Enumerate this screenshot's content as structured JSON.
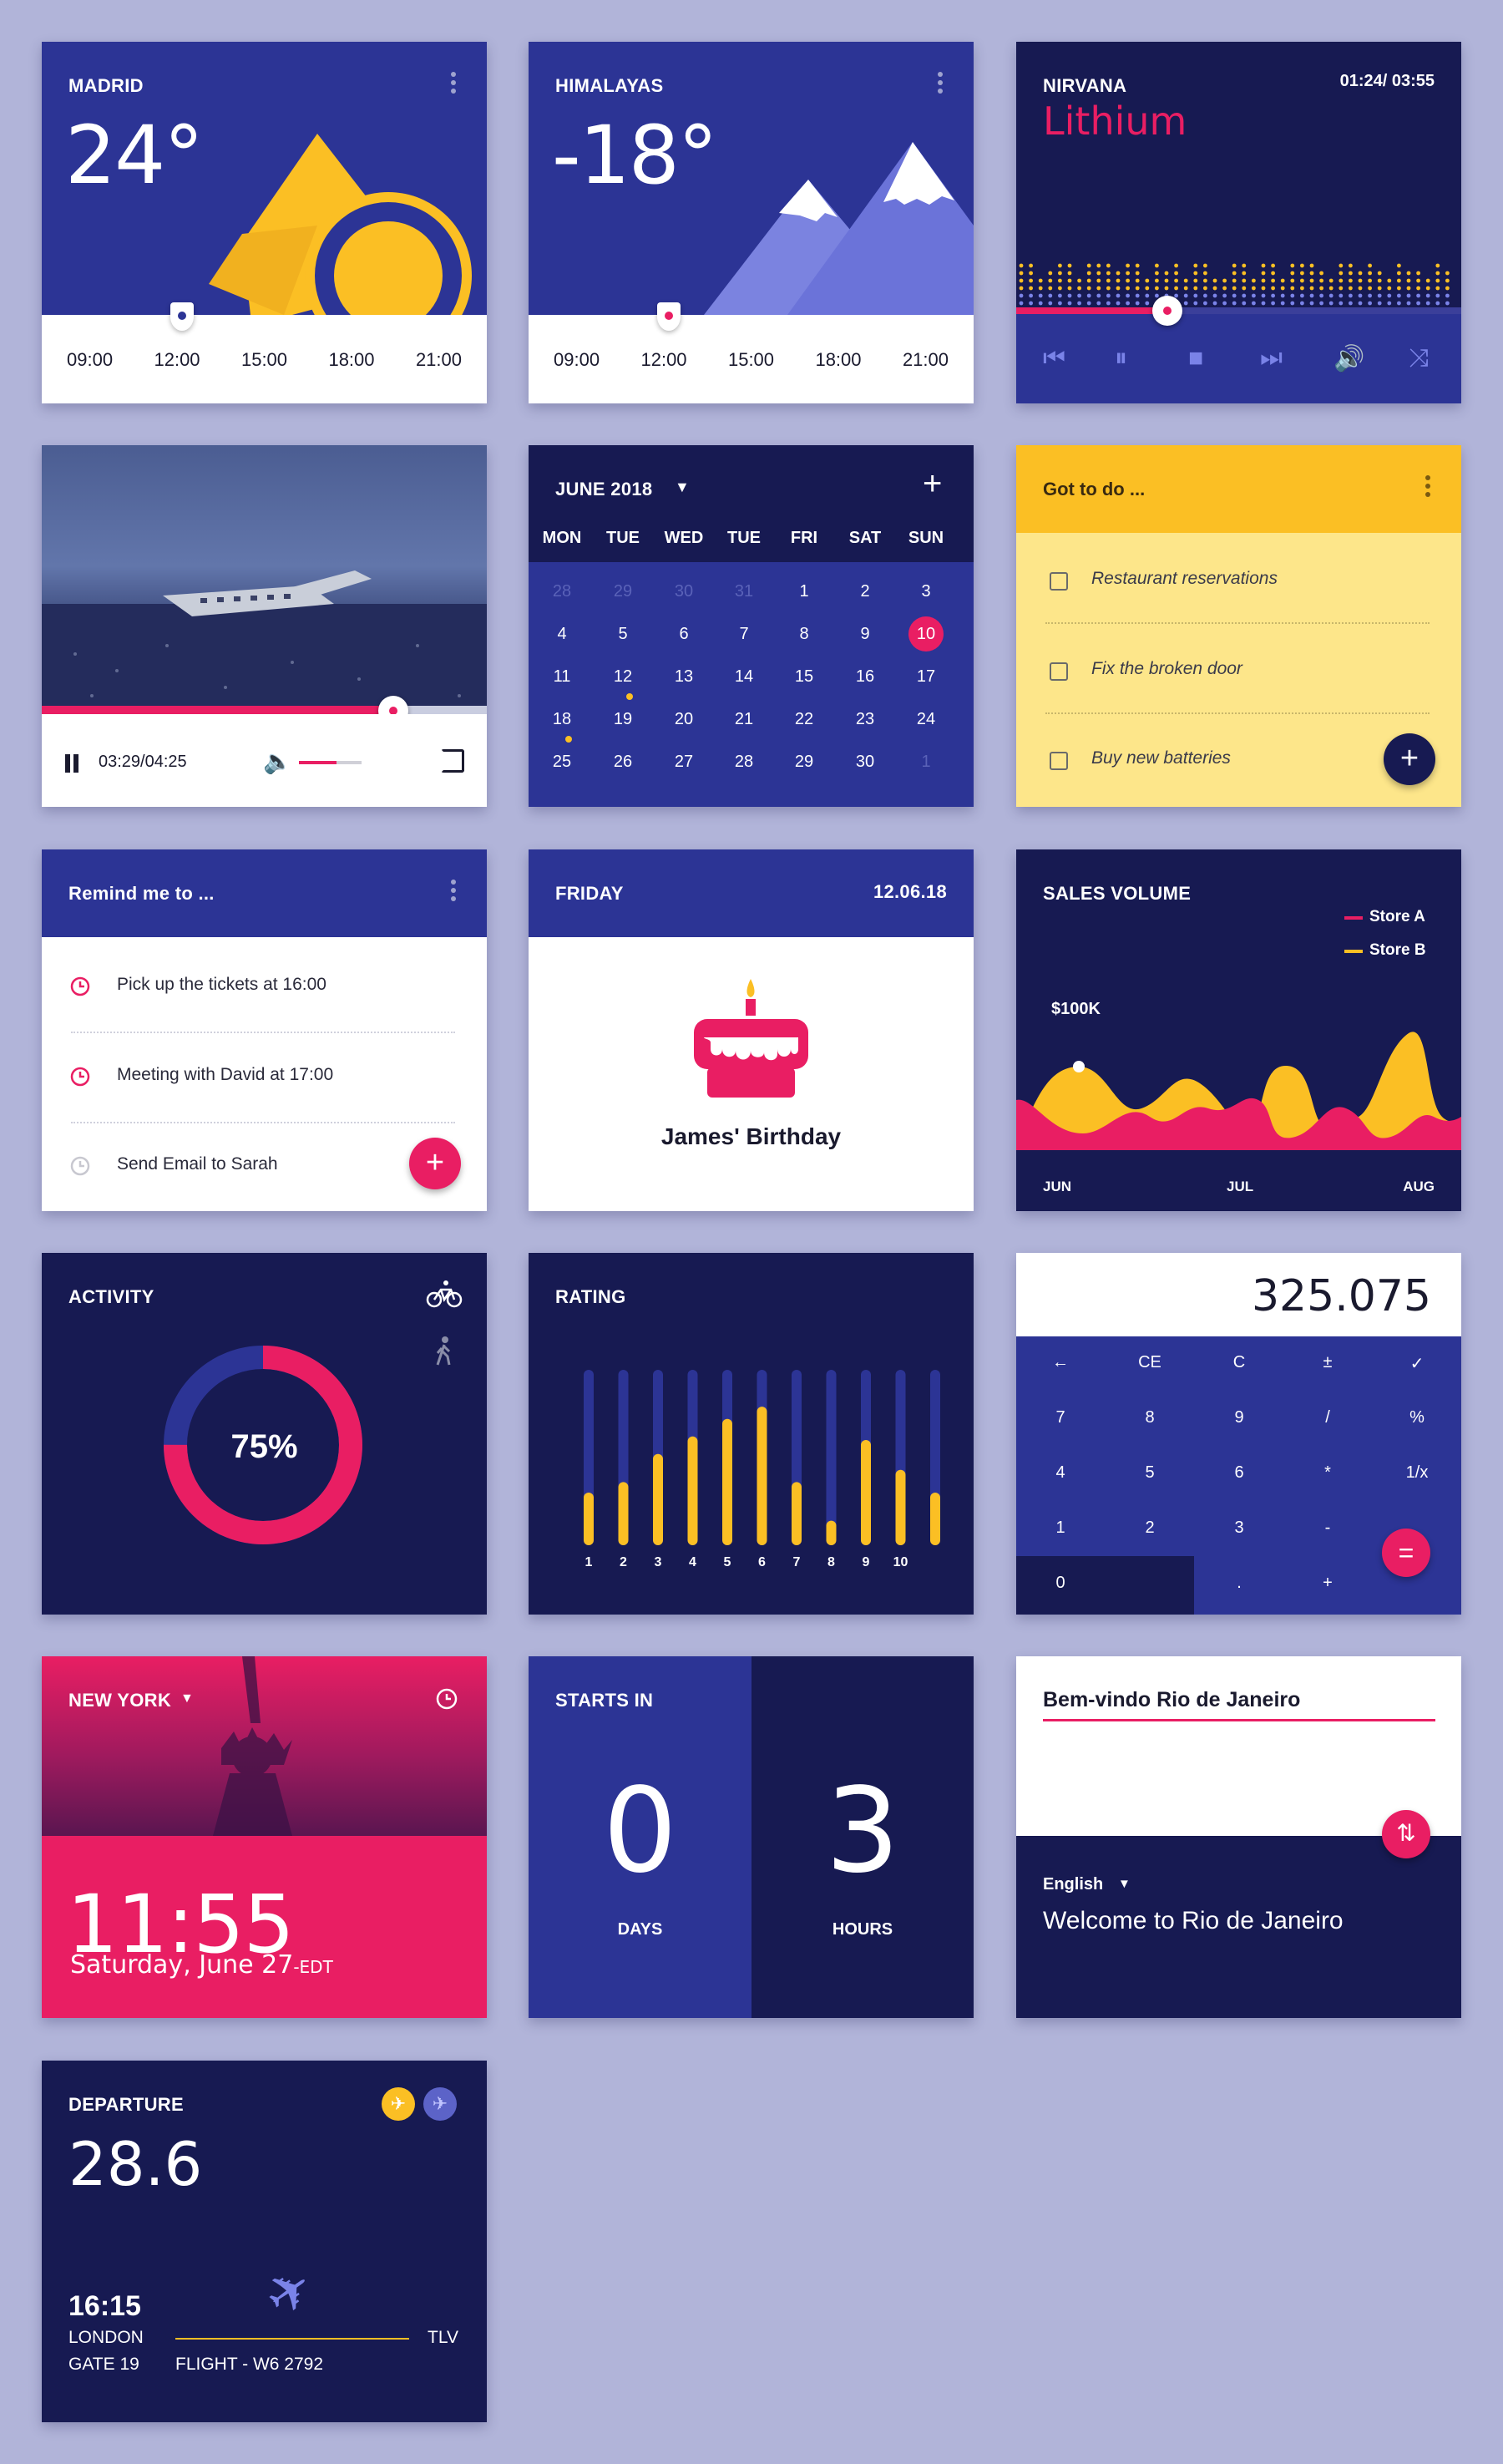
{
  "colors": {
    "background": "#b1b4d9",
    "indigo": "#2c3495",
    "navy": "#171a52",
    "pink": "#e91e63",
    "yellow": "#fbbf24",
    "periwinkle": "#7a83e8"
  },
  "weather_madrid": {
    "city": "MADRID",
    "temp": "24°",
    "times": [
      "09:00",
      "12:00",
      "15:00",
      "18:00",
      "21:00"
    ],
    "icon": "sun-icon"
  },
  "weather_himalayas": {
    "city": "HIMALAYAS",
    "temp": "-18°",
    "times": [
      "09:00",
      "12:00",
      "15:00",
      "18:00",
      "21:00"
    ],
    "icon": "mountain-icon"
  },
  "music": {
    "artist": "NIRVANA",
    "track": "Lithium",
    "time": "01:24/ 03:55",
    "progress": 0.34,
    "controls": [
      "previous-icon",
      "pause-icon",
      "stop-icon",
      "next-icon",
      "volume-icon",
      "shuffle-icon"
    ]
  },
  "video": {
    "time": "03:29/04:25",
    "progress": 0.79,
    "volume": 0.6
  },
  "calendar": {
    "month": "JUNE 2018",
    "weekdays": [
      "MON",
      "TUE",
      "WED",
      "TUE",
      "FRI",
      "SAT",
      "SUN"
    ],
    "weeks": [
      [
        "28",
        "29",
        "30",
        "31",
        "1",
        "2",
        "3"
      ],
      [
        "4",
        "5",
        "6",
        "7",
        "8",
        "9",
        "10"
      ],
      [
        "11",
        "12",
        "13",
        "14",
        "15",
        "16",
        "17"
      ],
      [
        "18",
        "19",
        "20",
        "21",
        "22",
        "23",
        "24"
      ],
      [
        "25",
        "26",
        "27",
        "28",
        "29",
        "30",
        "1"
      ]
    ],
    "selected": "10"
  },
  "todo": {
    "title": "Got to do ...",
    "items": [
      "Restaurant reservations",
      "Fix the broken door",
      "Buy new batteries"
    ],
    "add_label": "+"
  },
  "reminder": {
    "title": "Remind me to ...",
    "items": [
      "Pick up the tickets at 16:00",
      "Meeting with David at 17:00",
      "Send Email to Sarah"
    ],
    "add_label": "+"
  },
  "birthday": {
    "day": "FRIDAY",
    "date": "12.06.18",
    "text": "James' Birthday"
  },
  "sales": {
    "title": "SALES VOLUME",
    "legend": [
      "Store A",
      "Store B"
    ],
    "annotation": "$100K",
    "months": [
      "JUN",
      "JUL",
      "AUG"
    ]
  },
  "activity": {
    "title": "ACTIVITY",
    "percent": "75%",
    "value": 0.75
  },
  "rating": {
    "title": "RATING",
    "labels": [
      "1",
      "2",
      "3",
      "4",
      "5",
      "6",
      "7",
      "8",
      "9",
      "10"
    ],
    "values": [
      0.3,
      0.36,
      0.52,
      0.62,
      0.72,
      0.79,
      0.36,
      0.14,
      0.6,
      0.43,
      0.3
    ]
  },
  "calculator": {
    "display": "325.075",
    "rows": [
      [
        "←",
        "CE",
        "C",
        "±",
        "✓"
      ],
      [
        "7",
        "8",
        "9",
        "/",
        "%"
      ],
      [
        "4",
        "5",
        "6",
        "*",
        "1/x"
      ],
      [
        "1",
        "2",
        "3",
        "-",
        ""
      ],
      [
        "0",
        "",
        ".",
        "+",
        ""
      ]
    ],
    "equals": "="
  },
  "newyork": {
    "city": "NEW YORK",
    "time": "11:55",
    "date": "Saturday, June 27",
    "zone": "-EDT"
  },
  "countdown": {
    "title": "STARTS IN",
    "days": "0",
    "days_label": "DAYS",
    "hours": "3",
    "hours_label": "HOURS"
  },
  "translate": {
    "source": "Bem-vindo Rio de Janeiro",
    "language": "English",
    "target": "Welcome to Rio de Janeiro"
  },
  "departure": {
    "title": "DEPARTURE",
    "date": "28.6",
    "time": "16:15",
    "from": "LONDON",
    "to": "TLV",
    "gate": "GATE 19",
    "flight": "FLIGHT - W6 2792"
  }
}
